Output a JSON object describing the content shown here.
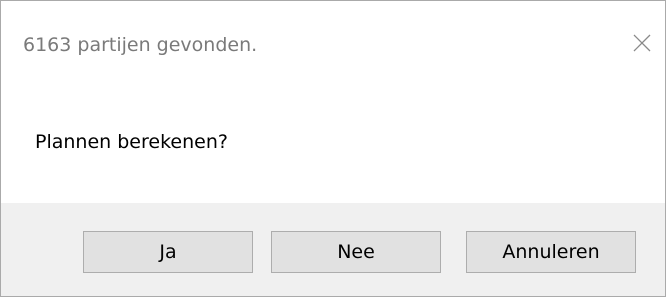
{
  "dialog": {
    "title": "6163 partijen gevonden.",
    "close_icon": "close-icon",
    "message": "Plannen berekenen?",
    "buttons": {
      "yes_label": "Ja",
      "no_label": "Nee",
      "cancel_label": "Annuleren"
    }
  }
}
